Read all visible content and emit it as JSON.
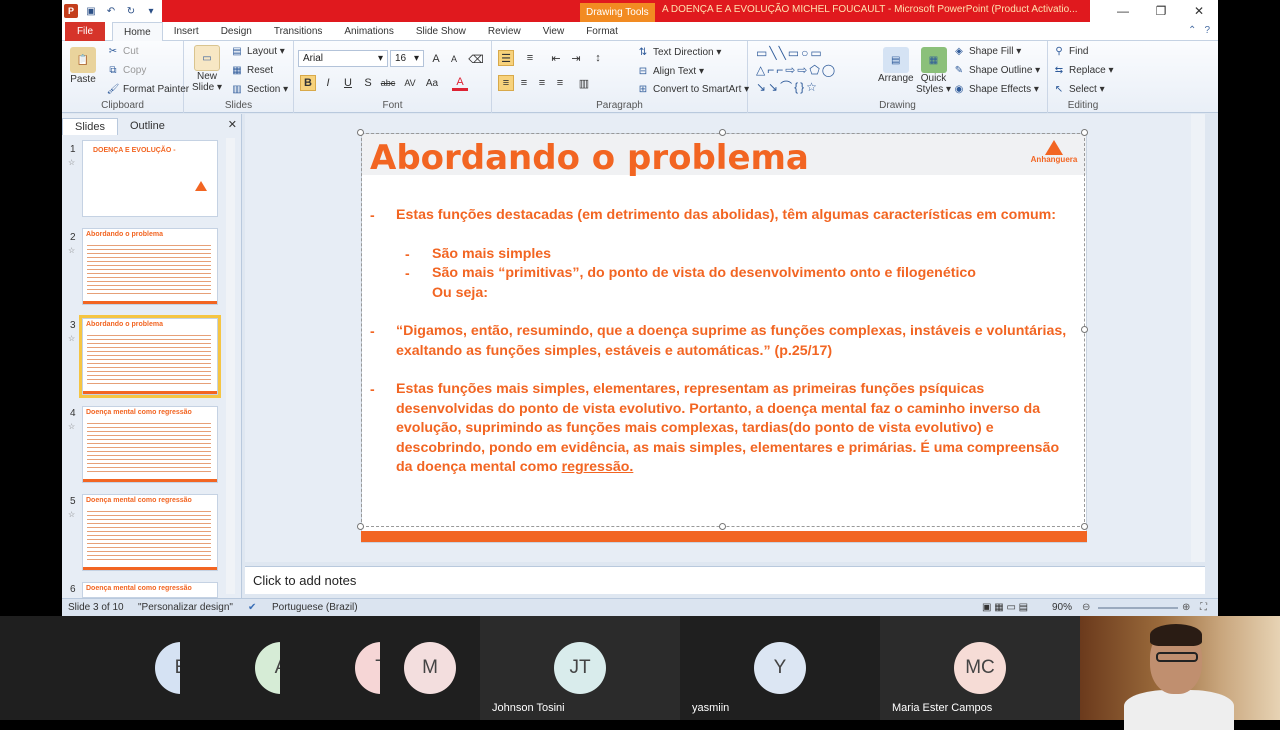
{
  "window": {
    "drawing_tools": "Drawing Tools",
    "title": "A DOENÇA E A EVOLUÇÃO MICHEL FOUCAULT  -  Microsoft PowerPoint (Product Activatio..."
  },
  "tabs": {
    "file": "File",
    "items": [
      "Home",
      "Insert",
      "Design",
      "Transitions",
      "Animations",
      "Slide Show",
      "Review",
      "View",
      "Format"
    ]
  },
  "ribbon": {
    "clipboard": {
      "label": "Clipboard",
      "paste": "Paste",
      "cut": "Cut",
      "copy": "Copy",
      "format_painter": "Format Painter"
    },
    "slides": {
      "label": "Slides",
      "new_slide": "New",
      "new_slide2": "Slide ▾",
      "layout": "Layout ▾",
      "reset": "Reset",
      "section": "Section ▾"
    },
    "font": {
      "label": "Font",
      "family": "Arial",
      "size": "16"
    },
    "paragraph": {
      "label": "Paragraph",
      "text_direction": "Text Direction ▾",
      "align_text": "Align Text ▾",
      "convert": "Convert to SmartArt ▾"
    },
    "drawing": {
      "label": "Drawing",
      "arrange": "Arrange",
      "quick_styles": "Quick",
      "quick_styles2": "Styles ▾",
      "shape_fill": "Shape Fill ▾",
      "shape_outline": "Shape Outline ▾",
      "shape_effects": "Shape Effects ▾"
    },
    "editing": {
      "label": "Editing",
      "find": "Find",
      "replace": "Replace ▾",
      "select": "Select ▾"
    }
  },
  "left_panel": {
    "tab_slides": "Slides",
    "tab_outline": "Outline",
    "thumbs": [
      {
        "num": "1",
        "title": "DOENÇA E EVOLUÇÃO -"
      },
      {
        "num": "2",
        "title": "Abordando o problema"
      },
      {
        "num": "3",
        "title": "Abordando o problema"
      },
      {
        "num": "4",
        "title": "Doença mental como regressão"
      },
      {
        "num": "5",
        "title": "Doença mental como regressão"
      },
      {
        "num": "6",
        "title": "Doença mental como regressão"
      }
    ]
  },
  "slide": {
    "title": "Abordando o problema",
    "logo_text": "Anhanguera",
    "bullet1": "Estas funções destacadas (em detrimento das abolidas), têm algumas características em comum:",
    "sub1": "São mais simples",
    "sub2": "São mais “primitivas”, do ponto de vista do desenvolvimento onto e filogenético",
    "sub3": "Ou seja:",
    "bullet2": "“Digamos, então, resumindo, que a doença suprime as funções complexas, instáveis e voluntárias, exaltando as funções simples, estáveis e automáticas.” (p.25/17)",
    "bullet3_main": "Estas funções mais simples, elementares, representam as primeiras funções psíquicas desenvolvidas do ponto de vista evolutivo. Portanto, a doença mental faz o caminho inverso da evolução, suprimindo as funções mais complexas, tardias(do ponto de vista evolutivo) e descobrindo, pondo em evidência, as mais simples, elementares e primárias. É uma compreensão da doença mental como ",
    "bullet3_link": "regressão.",
    "number": "3"
  },
  "notes": "Click to add notes",
  "status": {
    "slide_of": "Slide 3 of 10",
    "theme": "\"Personalizar design\"",
    "language": "Portuguese (Brazil)",
    "zoom": "90%"
  },
  "participants": [
    {
      "initials": "E",
      "name": "",
      "color": "#d5e2f3"
    },
    {
      "initials": "A",
      "name": "",
      "color": "#d6ecd6"
    },
    {
      "initials": "T",
      "name": "",
      "color": "#f6d6d6"
    },
    {
      "initials": "M",
      "name": "",
      "color": "#f3dede"
    },
    {
      "initials": "JT",
      "name": "Johnson Tosini",
      "color": "#d9ecec"
    },
    {
      "initials": "Y",
      "name": "yasmiin",
      "color": "#dce6f3"
    },
    {
      "initials": "MC",
      "name": "Maria Ester Campos",
      "color": "#f6dcd6"
    }
  ]
}
